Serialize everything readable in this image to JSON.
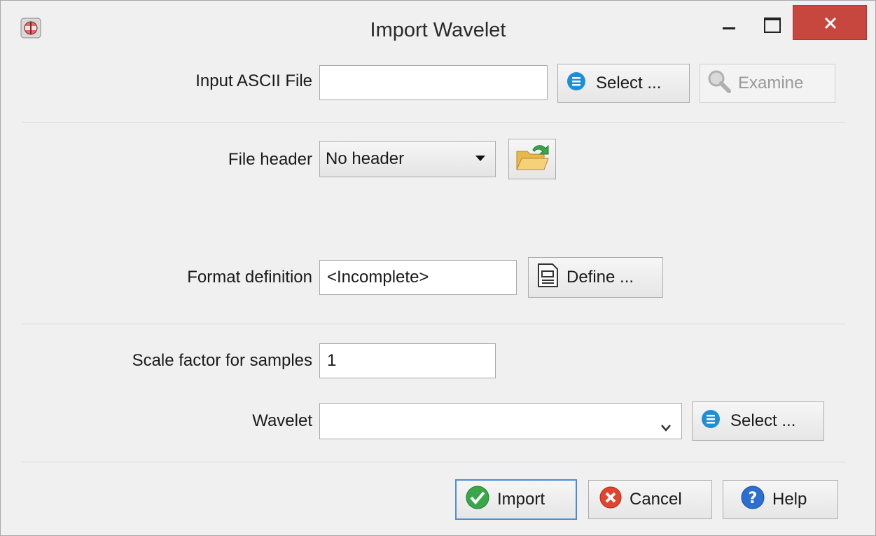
{
  "window": {
    "title": "Import Wavelet",
    "app_icon": "app-icon",
    "controls": [
      "minimize-icon",
      "maximize-icon",
      "close-icon"
    ]
  },
  "input_file": {
    "label": "Input ASCII File",
    "value": "",
    "select_label": "Select ...",
    "select_icon": "list-icon",
    "examine_label": "Examine",
    "examine_icon": "magnifier-icon"
  },
  "file_header": {
    "label": "File header",
    "selected": "No header",
    "open_icon": "folder-open-icon"
  },
  "format": {
    "label": "Format definition",
    "value": "<Incomplete>",
    "define_label": "Define ...",
    "define_icon": "document-icon"
  },
  "scale": {
    "label": "Scale factor for samples",
    "value": "1"
  },
  "wavelet": {
    "label": "Wavelet",
    "value": "",
    "select_label": "Select ...",
    "select_icon": "list-icon"
  },
  "footer": {
    "import_label": "Import",
    "cancel_label": "Cancel",
    "help_label": "Help"
  },
  "colors": {
    "close_button": "#c7463d",
    "default_button_border": "#4a90d9",
    "select_icon": "#1e8fd6",
    "import_icon": "#3aa64a",
    "cancel_icon": "#e1452f",
    "help_icon": "#2a6fd1"
  }
}
